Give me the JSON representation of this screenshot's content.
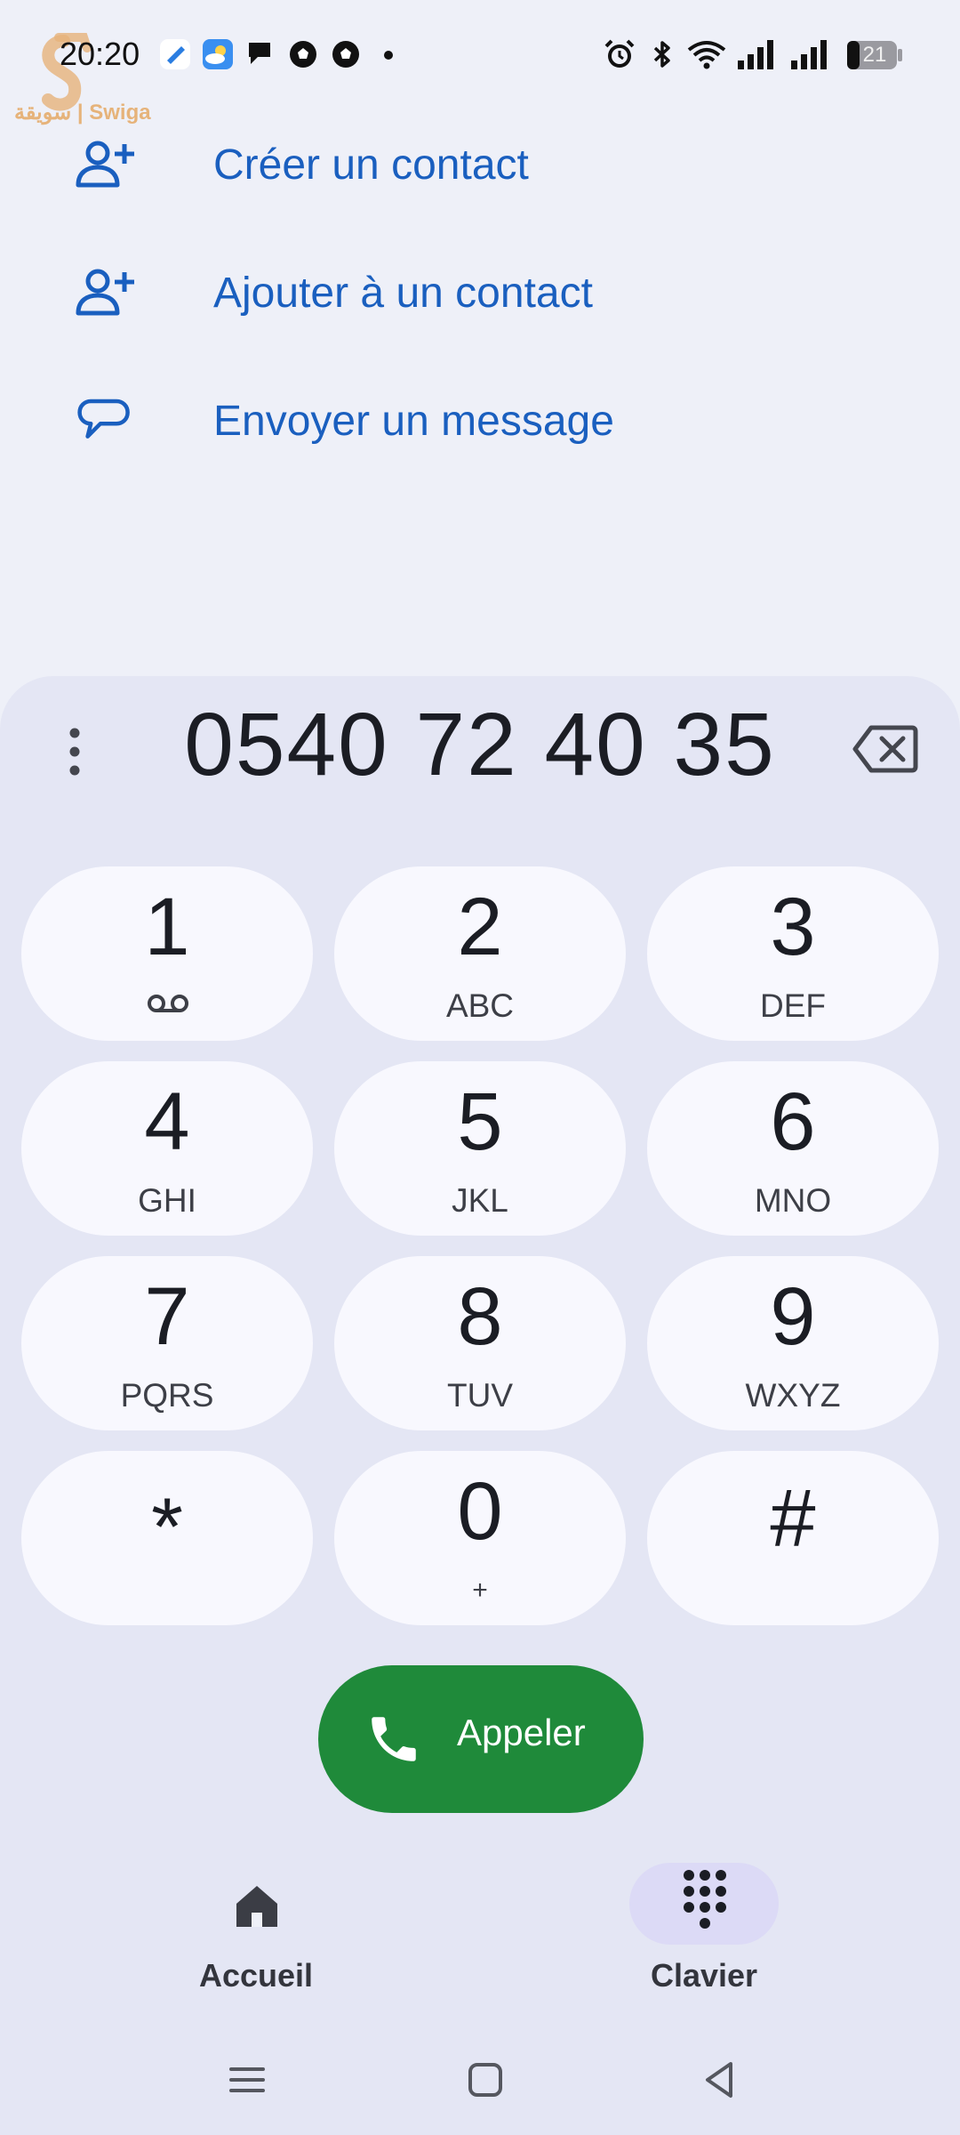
{
  "status_bar": {
    "time": "20:20",
    "battery": "21",
    "icons": [
      "app-icon",
      "weather-icon",
      "chat-icon",
      "soccer-ball-icon",
      "soccer-ball-icon",
      "notification-dot",
      "alarm-icon",
      "bluetooth-icon",
      "wifi-icon",
      "signal-icon",
      "signal-icon",
      "battery-icon"
    ]
  },
  "watermark": {
    "text": "سويقة | Swiga"
  },
  "actions": [
    {
      "label": "Créer un contact",
      "icon": "person-add-icon"
    },
    {
      "label": "Ajouter à un contact",
      "icon": "person-add-icon"
    },
    {
      "label": "Envoyer un message",
      "icon": "message-icon"
    }
  ],
  "dialer": {
    "number": "0540 72 40 35",
    "keys": [
      {
        "digit": "1",
        "letters": ""
      },
      {
        "digit": "2",
        "letters": "ABC"
      },
      {
        "digit": "3",
        "letters": "DEF"
      },
      {
        "digit": "4",
        "letters": "GHI"
      },
      {
        "digit": "5",
        "letters": "JKL"
      },
      {
        "digit": "6",
        "letters": "MNO"
      },
      {
        "digit": "7",
        "letters": "PQRS"
      },
      {
        "digit": "8",
        "letters": "TUV"
      },
      {
        "digit": "9",
        "letters": "WXYZ"
      },
      {
        "digit": "*",
        "letters": ""
      },
      {
        "digit": "0",
        "letters": "+"
      },
      {
        "digit": "#",
        "letters": ""
      }
    ],
    "call_label": "Appeler"
  },
  "bottom_nav": {
    "items": [
      {
        "label": "Accueil",
        "icon": "home-icon"
      },
      {
        "label": "Clavier",
        "icon": "dialpad-icon",
        "active": true
      }
    ]
  },
  "colors": {
    "accent": "#1a5fbf",
    "call_green": "#1f8a3a",
    "background": "#eef0f8",
    "sheet": "#e4e6f4",
    "key": "#f8f8fe"
  }
}
